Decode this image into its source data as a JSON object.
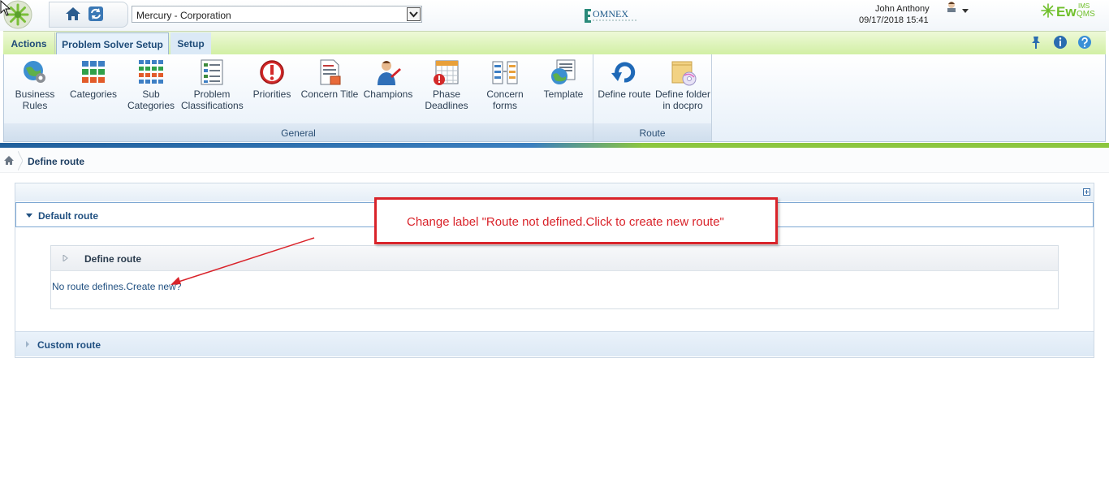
{
  "header": {
    "site_value": "Mercury - Corporation",
    "user_name": "John Anthony",
    "datetime": "09/17/2018 15:41",
    "omnex_logo_text": "OMNEX",
    "ewqms_logo_text": "EwQMS",
    "ims_text": "IMS"
  },
  "ribbon": {
    "tabs": [
      {
        "label": "Actions",
        "active": false
      },
      {
        "label": "Problem Solver Setup",
        "active": true
      },
      {
        "label": "Setup",
        "active": false
      }
    ],
    "groups": [
      {
        "label": "General",
        "buttons": [
          {
            "label": "Business Rules",
            "icon": "globe-gear-icon"
          },
          {
            "label": "Categories",
            "icon": "grid-icon"
          },
          {
            "label": "Sub Categories",
            "icon": "sub-grid-icon"
          },
          {
            "label": "Problem Classifications",
            "icon": "list-document-icon"
          },
          {
            "label": "Priorities",
            "icon": "exclamation-icon"
          },
          {
            "label": "Concern Title",
            "icon": "document-title-icon"
          },
          {
            "label": "Champions",
            "icon": "person-icon"
          },
          {
            "label": "Phase Deadlines",
            "icon": "calendar-alert-icon"
          },
          {
            "label": "Concern forms",
            "icon": "form-icon"
          },
          {
            "label": "Template",
            "icon": "template-globe-icon"
          }
        ]
      },
      {
        "label": "Route",
        "buttons": [
          {
            "label": "Define route",
            "icon": "route-refresh-icon"
          },
          {
            "label": "Define folder in docpro",
            "icon": "folder-cd-icon"
          }
        ]
      }
    ]
  },
  "breadcrumb": {
    "current": "Define route"
  },
  "sections": {
    "default": {
      "title": "Default route",
      "inner_title": "Define route",
      "link_text": "No route defines.Create new?"
    },
    "custom": {
      "title": "Custom route"
    }
  },
  "annotation": {
    "text": "Change label \"Route not defined.Click to create new route\"",
    "color": "#d9232a"
  },
  "colors": {
    "ribbon_green": "#d2efa4",
    "tab_text": "#1e4b78",
    "accent_blue": "#1f5f9c"
  }
}
